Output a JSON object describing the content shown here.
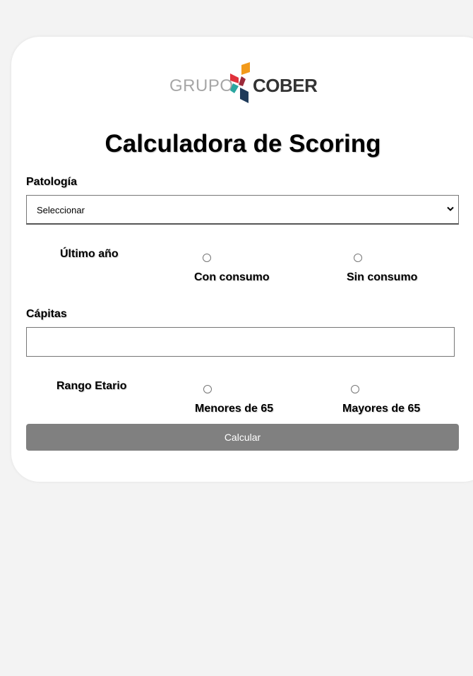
{
  "logo": {
    "left_text": "GRUPO",
    "right_text": "COBER",
    "colors": {
      "orange": "#f29a1b",
      "red": "#e0313b",
      "teal": "#2aa6a0",
      "navy": "#1f3a5a"
    }
  },
  "title": "Calculadora de Scoring",
  "patologia": {
    "label": "Patología",
    "selected": "Seleccionar"
  },
  "ultimo_anio": {
    "label": "Último año",
    "options": [
      "Con consumo",
      "Sin consumo"
    ]
  },
  "capitas": {
    "label": "Cápitas",
    "value": ""
  },
  "rango_etario": {
    "label": "Rango Etario",
    "options": [
      "Menores de 65",
      "Mayores de 65"
    ]
  },
  "calcular_button": "Calcular",
  "colors": {
    "background": "#f3f3f3",
    "card": "#ffffff",
    "button": "#808080"
  }
}
